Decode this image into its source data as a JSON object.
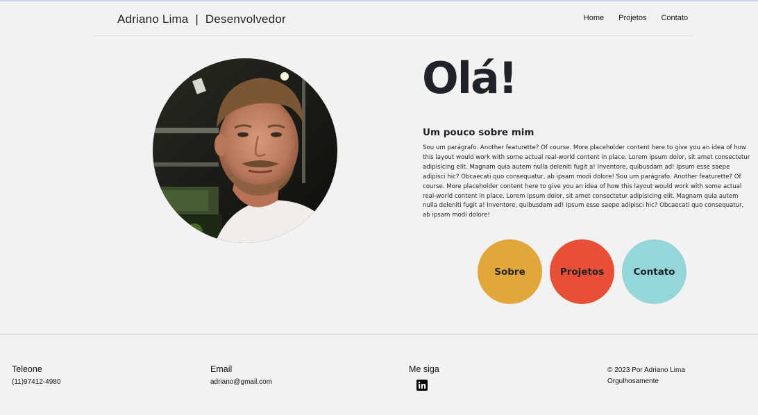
{
  "header": {
    "brand": "Adriano Lima  |  Desenvolvedor",
    "nav": [
      "Home",
      "Projetos",
      "Contato"
    ]
  },
  "hero": {
    "greeting": "Olá!",
    "about_title": "Um pouco sobre mim",
    "about_text": "Sou um parágrafo. Another featurette? Of course. More placeholder content here to give you an idea of how this layout would work with some actual real-world content in place. Lorem ipsum dolor, sit amet consectetur adipisicing elit. Magnam quia autem nulla deleniti fugit a! Inventore, quibusdam ad! Ipsum esse saepe adipisci hic? Obcaecati quo consequatur, ab ipsam modi dolore! Sou um parágrafo. Another featurette? Of course. More placeholder content here to give you an idea of how this layout would work with some actual real-world content in place. Lorem ipsum dolor, sit amet consectetur adipisicing elit. Magnam quia autem nulla deleniti fugit a! Inventore, quibusdam ad! Ipsum esse saepe adipisci hic? Obcaecati quo consequatur, ab ipsam modi dolore!",
    "buttons": [
      {
        "label": "Sobre",
        "color": "#e3a63b"
      },
      {
        "label": "Projetos",
        "color": "#e84f37"
      },
      {
        "label": "Contato",
        "color": "#95d7d9"
      }
    ]
  },
  "footer": {
    "phone_title": "Teleone",
    "phone_value": "(11)97412-4980",
    "email_title": "Email",
    "email_value": "adriano@gmail.com",
    "follow_title": "Me siga",
    "follow_icon": "linkedin-icon",
    "copyright_line1": "© 2023 Por Adriano Lima",
    "copyright_line2": "Orgulhosamente"
  }
}
